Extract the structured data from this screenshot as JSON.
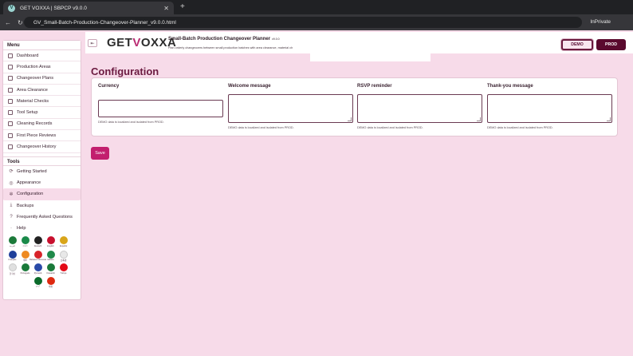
{
  "browser": {
    "tab_title": "GET VOXXA | SBPCP v9.0.0",
    "favicon": "V",
    "close_glyph": "✕",
    "new_tab_glyph": "+",
    "back_glyph": "←",
    "refresh_glyph": "↻",
    "url": "GV_Small-Batch-Production-Changeover-Planner_v9.0.0.html",
    "mode": "InPrivate"
  },
  "header": {
    "collapse_glyph": "⇤",
    "logo_prefix": "GET",
    "logo_v": "V",
    "logo_suffix": "OXXA",
    "app_title": "Small-Batch Production Changeover Planner",
    "app_version": "v9.0.0",
    "app_subtitle": "Plan orderly changeovers between small production batches with area clearance, material ch",
    "demo_label": "DEMO",
    "prod_label": "PROD"
  },
  "sidebar": {
    "menu_title": "Menu",
    "menu_items": [
      {
        "label": "Dashboard"
      },
      {
        "label": "Production Areas"
      },
      {
        "label": "Changeover Plans"
      },
      {
        "label": "Area Clearance"
      },
      {
        "label": "Material Checks"
      },
      {
        "label": "Tool Setup"
      },
      {
        "label": "Cleaning Records"
      },
      {
        "label": "First Piece Reviews"
      },
      {
        "label": "Changeover History"
      }
    ],
    "tools_title": "Tools",
    "tools_items": [
      {
        "label": "Getting Started",
        "icon": "⟳"
      },
      {
        "label": "Appearance",
        "icon": "◎"
      },
      {
        "label": "Configuration",
        "icon": "✲"
      },
      {
        "label": "Backups",
        "icon": "⤓"
      },
      {
        "label": "Frequently Asked Questions",
        "icon": "?"
      },
      {
        "label": "Help",
        "icon": "·"
      }
    ],
    "languages": [
      {
        "label": "العربية",
        "color": "#1c7a3a"
      },
      {
        "label": "বাংলা",
        "color": "#1a8a4a"
      },
      {
        "label": "Deutsch",
        "color": "#222222"
      },
      {
        "label": "English",
        "color": "#c8102e"
      },
      {
        "label": "Español",
        "color": "#d9a51a"
      },
      {
        "label": "",
        "color": "#ffffff"
      },
      {
        "label": "Français",
        "color": "#1f3f9a"
      },
      {
        "label": "हिंदी",
        "color": "#ee8a22"
      },
      {
        "label": "Bahasa Indonesia",
        "color": "#d8232a"
      },
      {
        "label": "Italiano",
        "color": "#1f8a4a"
      },
      {
        "label": "日本語",
        "color": "#e8e8e8"
      },
      {
        "label": "",
        "color": "#ffffff"
      },
      {
        "label": "한국어",
        "color": "#e0e0e0"
      },
      {
        "label": "Português",
        "color": "#1a7a3a"
      },
      {
        "label": "Pусский",
        "color": "#2a4aa8"
      },
      {
        "label": "Kiswahili",
        "color": "#1a7a3a"
      },
      {
        "label": "Türkçe",
        "color": "#e30a17"
      },
      {
        "label": "",
        "color": "#ffffff"
      },
      {
        "label": "",
        "color": "#ffffff"
      },
      {
        "label": "",
        "color": "#ffffff"
      },
      {
        "label": "اردو",
        "color": "#0a6a2a"
      },
      {
        "label": "中文",
        "color": "#de2910"
      }
    ]
  },
  "main": {
    "title": "Configuration",
    "fields": [
      {
        "label": "Currency",
        "note": "DEMO data is localized and isolated from PROD."
      },
      {
        "label": "Welcome message",
        "note": "DEMO data is localized and isolated from PROD."
      },
      {
        "label": "RSVP reminder",
        "note": "DEMO data is localized and isolated from PROD."
      },
      {
        "label": "Thank-you message",
        "note": "DEMO data is localized and isolated from PROD."
      }
    ],
    "save_label": "Save"
  },
  "colors": {
    "page_bg": "#f7dbe9",
    "accent": "#c21f6e",
    "title": "#6b1a40",
    "prod": "#5a0a2e"
  }
}
